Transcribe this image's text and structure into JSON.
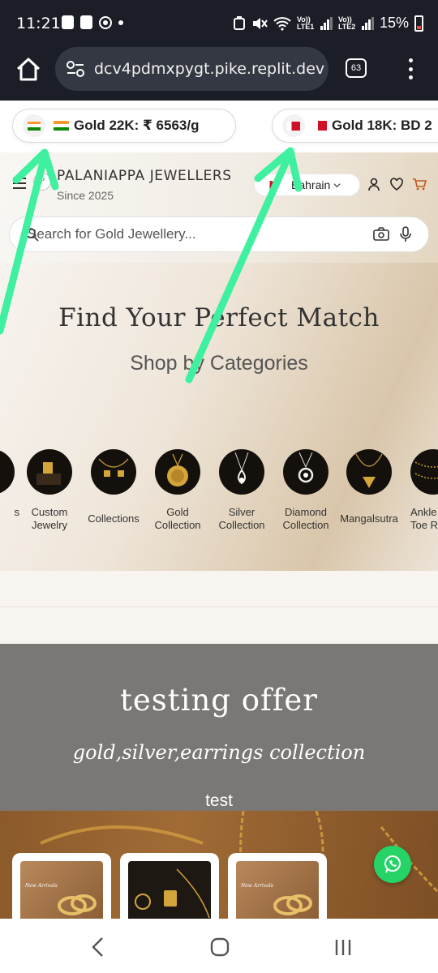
{
  "status_bar": {
    "time": "11:21",
    "battery": "15%",
    "net_label_1": "Vo)) LTE1",
    "net_label_2": "Vo)) LTE2"
  },
  "browser": {
    "url": "dcv4pdmxpygt.pike.replit.dev",
    "tab_count": "63"
  },
  "ticker": {
    "items": [
      {
        "flag": "India",
        "text": "Gold 22K: ₹ 6563/g"
      },
      {
        "flag": "Bahrain",
        "text": "Gold 18K: BD 2"
      }
    ]
  },
  "header": {
    "logo_letter": "P",
    "brand": "PALANIAPPA JEWELLERS",
    "since": "Since 2025",
    "country": "Bahrain",
    "search_placeholder": "Search for Gold Jewellery..."
  },
  "hero": {
    "title": "Find Your Perfect Match",
    "subtitle": "Shop by Categories",
    "categories": [
      {
        "label": "s"
      },
      {
        "label": "Custom\nJewelry"
      },
      {
        "label": "Collections"
      },
      {
        "label": "Gold\nCollection"
      },
      {
        "label": "Silver\nCollection"
      },
      {
        "label": "Diamond\nCollection"
      },
      {
        "label": "Mangalsutra"
      },
      {
        "label": "Ankle\nToe R"
      }
    ]
  },
  "offer": {
    "title": "testing offer",
    "subtitle": "gold,silver,earrings collection",
    "note": "test"
  },
  "products": {
    "card_caption": "New Arrivals"
  },
  "colors": {
    "accent_arrow": "#3ef0a0",
    "whatsapp": "#25d366",
    "cart": "#c0561b"
  }
}
